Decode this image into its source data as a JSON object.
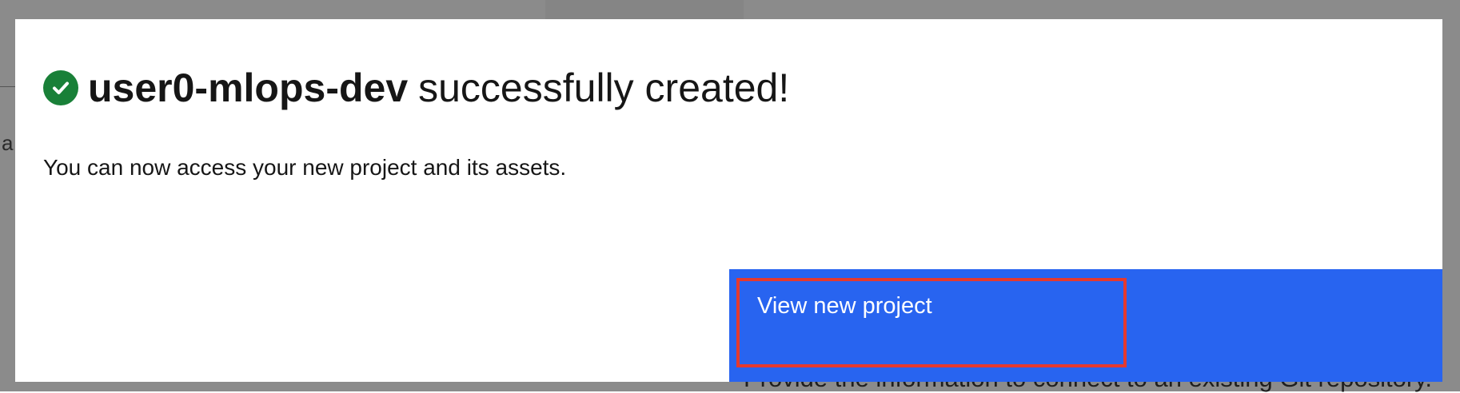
{
  "background": {
    "partial_letter": "a",
    "bottom_text": "Provide the information to connect to an existing Git repository."
  },
  "modal": {
    "project_name": "user0-mlops-dev",
    "title_suffix": "successfully created!",
    "description": "You can now access your new project and its assets.",
    "status_icon": "checkmark-filled-icon",
    "success_color": "#198038",
    "primary_button": {
      "label": "View new project",
      "color": "#2864f0",
      "highlight_color": "#e5392f"
    }
  }
}
